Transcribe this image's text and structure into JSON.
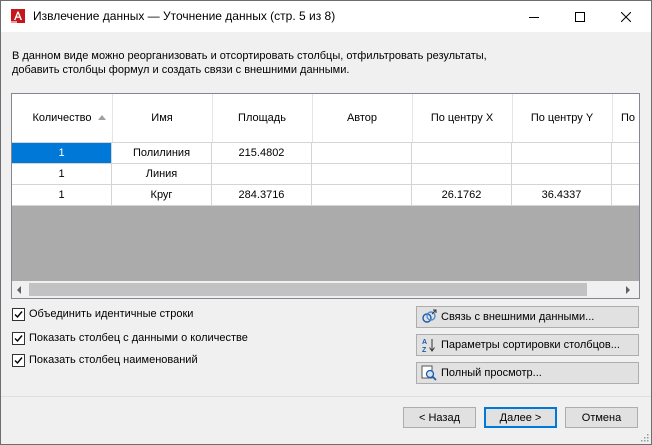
{
  "window": {
    "title": "Извлечение данных — Уточнение данных (стр. 5 из 8)",
    "icon": "autocad-a-icon"
  },
  "description": {
    "line1": "В данном виде можно реорганизовать и отсортировать столбцы, отфильтровать результаты,",
    "line2": "добавить столбцы формул и создать связи с внешними данными."
  },
  "grid": {
    "columns": [
      "Количество",
      "Имя",
      "Площадь",
      "Автор",
      "По центру X",
      "По центру Y",
      "По"
    ],
    "sorted_column": "Количество",
    "rows": [
      [
        "1",
        "Полилиния",
        "215.4802",
        "",
        "",
        "",
        ""
      ],
      [
        "1",
        "Линия",
        "",
        "",
        "",
        "",
        ""
      ],
      [
        "1",
        "Круг",
        "284.3716",
        "",
        "26.1762",
        "36.4337",
        ""
      ]
    ]
  },
  "options": {
    "combine_rows": {
      "label": "Объединить идентичные строки",
      "checked": true
    },
    "show_count": {
      "label": "Показать столбец с данными о количестве",
      "checked": true
    },
    "show_names": {
      "label": "Показать столбец наименований",
      "checked": true
    }
  },
  "buttons": {
    "link_external": "Связь с внешними данными...",
    "sort_columns": "Параметры сортировки столбцов...",
    "full_preview": "Полный просмотр...",
    "back": "< Назад",
    "next": "Далее >",
    "cancel": "Отмена"
  },
  "colors": {
    "selection": "#0078d7",
    "grid_background": "#ababab",
    "dialog_background": "#f0f0f0",
    "app_icon": "#c4161c"
  }
}
